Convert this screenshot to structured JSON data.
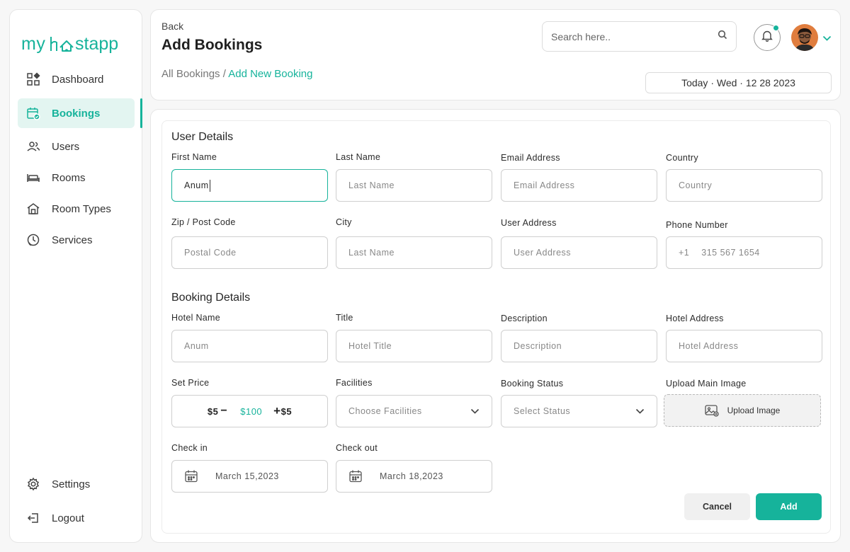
{
  "brand": {
    "logo_text": "myhostapp",
    "accent": "#16b39b"
  },
  "sidebar": {
    "items": [
      {
        "label": "Dashboard",
        "icon": "dashboard-icon"
      },
      {
        "label": "Bookings",
        "icon": "calendar-check-icon",
        "active": true
      },
      {
        "label": "Users",
        "icon": "users-icon"
      },
      {
        "label": "Rooms",
        "icon": "bed-icon"
      },
      {
        "label": "Room Types",
        "icon": "house-icon"
      },
      {
        "label": "Services",
        "icon": "clock-phone-icon"
      }
    ],
    "footer_items": [
      {
        "label": "Settings",
        "icon": "gear-icon"
      },
      {
        "label": "Logout",
        "icon": "logout-icon"
      }
    ]
  },
  "header": {
    "back_label": "Back",
    "title": "Add Bookings",
    "breadcrumb_root": "All Bookings",
    "breadcrumb_sep": " / ",
    "breadcrumb_current": "Add New Booking",
    "search_placeholder": "Search here..",
    "date_label": "Today · Wed · 12 28 2023"
  },
  "user_details": {
    "section_title": "User Details",
    "first_name": {
      "label": "First Name",
      "value": "Anum"
    },
    "last_name": {
      "label": "Last Name",
      "placeholder": "Last Name"
    },
    "email": {
      "label": "Email Address",
      "placeholder": "Email Address"
    },
    "country": {
      "label": "Country",
      "placeholder": "Country"
    },
    "zip": {
      "label": "Zip / Post Code",
      "placeholder": "Postal Code"
    },
    "city": {
      "label": "City",
      "placeholder": "Last Name"
    },
    "address": {
      "label": "User Address",
      "placeholder": "User Address"
    },
    "phone": {
      "label": "Phone Number",
      "code": "+1",
      "placeholder": "315 567 1654"
    }
  },
  "booking_details": {
    "section_title": "Booking Details",
    "hotel_name": {
      "label": "Hotel Name",
      "placeholder": "Anum"
    },
    "title": {
      "label": "Title",
      "placeholder": "Hotel Title"
    },
    "description": {
      "label": "Description",
      "placeholder": "Description"
    },
    "hotel_address": {
      "label": "Hotel Address",
      "placeholder": "Hotel Address"
    },
    "set_price": {
      "label": "Set Price",
      "min": "$5",
      "value": "$100",
      "max": "$5"
    },
    "facilities": {
      "label": "Facilities",
      "placeholder": "Choose Facilities"
    },
    "booking_status": {
      "label": "Booking Status",
      "placeholder": "Select Status"
    },
    "upload": {
      "label": "Upload Main Image",
      "button_label": "Upload Image"
    },
    "check_in": {
      "label": "Check in",
      "value": "March 15,2023"
    },
    "check_out": {
      "label": "Check out",
      "value": "March 18,2023"
    }
  },
  "actions": {
    "cancel_label": "Cancel",
    "add_label": "Add"
  }
}
